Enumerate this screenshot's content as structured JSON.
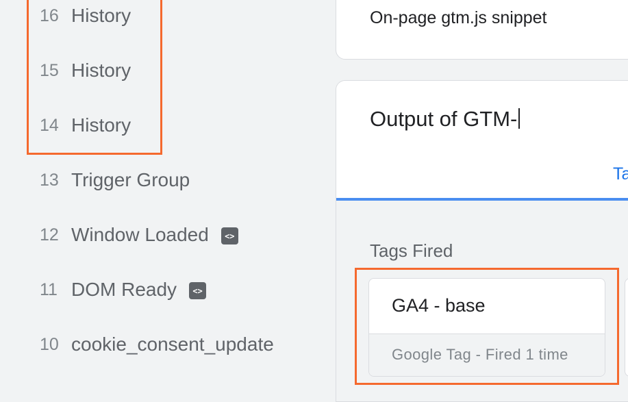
{
  "sidebar": {
    "events": [
      {
        "num": "16",
        "label": "History",
        "has_code_icon": false
      },
      {
        "num": "15",
        "label": "History",
        "has_code_icon": false
      },
      {
        "num": "14",
        "label": "History",
        "has_code_icon": false
      },
      {
        "num": "13",
        "label": "Trigger Group",
        "has_code_icon": false
      },
      {
        "num": "12",
        "label": "Window Loaded",
        "has_code_icon": true
      },
      {
        "num": "11",
        "label": "DOM Ready",
        "has_code_icon": true
      },
      {
        "num": "10",
        "label": "cookie_consent_update",
        "has_code_icon": false
      }
    ]
  },
  "snippet_card": {
    "text": "On-page gtm.js snippet"
  },
  "output_card": {
    "title": "Output of GTM-",
    "tab_label": "Ta",
    "section_title": "Tags Fired",
    "tags": [
      {
        "name": "GA4 - base",
        "status": "Google Tag - Fired 1 time"
      }
    ]
  },
  "icons": {
    "code_icon": "code-icon"
  },
  "colors": {
    "highlight": "#f5692e",
    "accent": "#1a73e8",
    "background": "#f1f3f4"
  }
}
